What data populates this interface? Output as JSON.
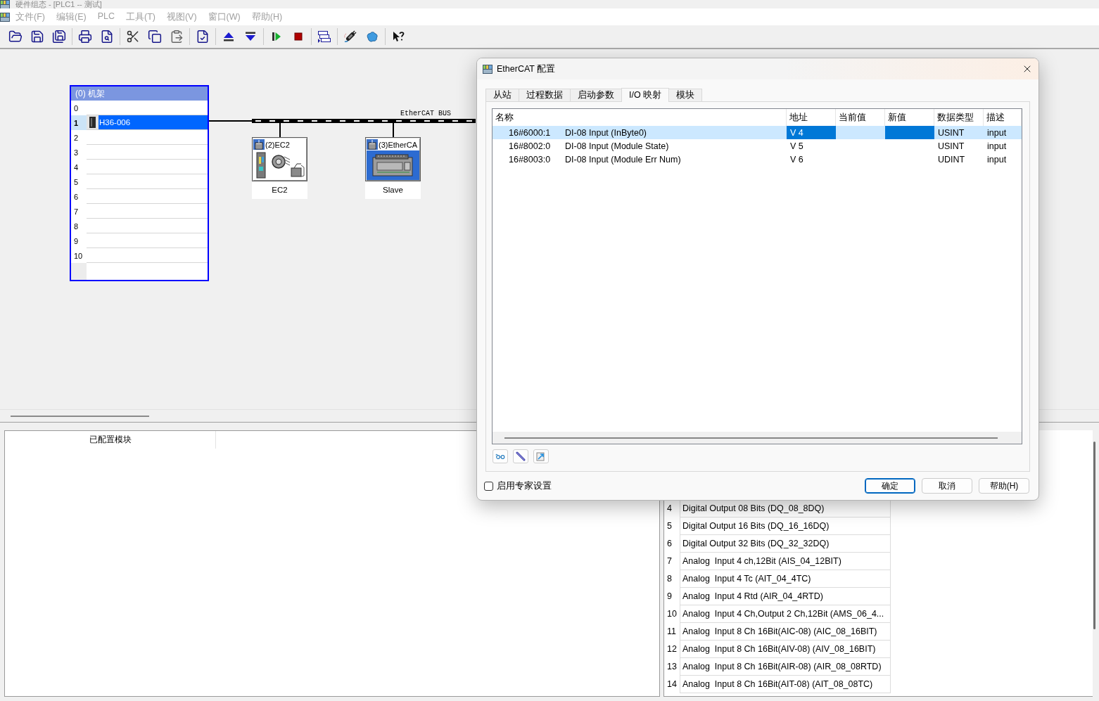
{
  "window": {
    "title": "硬件组态 - [PLC1 -- 测试]"
  },
  "menu": [
    {
      "label": "文件(F)",
      "disabled": true
    },
    {
      "label": "编辑(E)",
      "disabled": true
    },
    {
      "label": "PLC",
      "disabled": true
    },
    {
      "label": "工具(T)",
      "disabled": true
    },
    {
      "label": "视图(V)",
      "disabled": true
    },
    {
      "label": "窗口(W)",
      "disabled": true
    },
    {
      "label": "帮助(H)",
      "disabled": true
    }
  ],
  "rack": {
    "title": "(0) 机架",
    "slots": [
      {
        "number": "0",
        "selected": false
      },
      {
        "number": "1",
        "module": "H36-006",
        "selected": true
      },
      {
        "number": "2",
        "selected": false
      },
      {
        "number": "3",
        "selected": false
      },
      {
        "number": "4",
        "selected": false
      },
      {
        "number": "5",
        "selected": false
      },
      {
        "number": "6",
        "selected": false
      },
      {
        "number": "7",
        "selected": false
      },
      {
        "number": "8",
        "selected": false
      },
      {
        "number": "9",
        "selected": false
      },
      {
        "number": "10",
        "selected": false
      }
    ]
  },
  "bus": {
    "label": "EtherCAT BUS",
    "nodes": [
      {
        "title": "(2)EC2",
        "label": "EC2",
        "kind": "drive",
        "selected": false
      },
      {
        "title": "(3)EtherCA",
        "label": "Slave",
        "kind": "plc",
        "selected": true
      }
    ]
  },
  "configured_modules": {
    "header": "已配置模块"
  },
  "module_list": {
    "rows": [
      {
        "number": "4",
        "name": "Digital Output 08 Bits (DQ_08_8DQ)"
      },
      {
        "number": "5",
        "name": "Digital Output 16 Bits (DQ_16_16DQ)"
      },
      {
        "number": "6",
        "name": "Digital Output 32 Bits (DQ_32_32DQ)"
      },
      {
        "number": "7",
        "name": "Analog  Input 4 ch,12Bit (AIS_04_12BIT)"
      },
      {
        "number": "8",
        "name": "Analog  Input 4 Tc (AIT_04_4TC)"
      },
      {
        "number": "9",
        "name": "Analog  Input 4 Rtd (AIR_04_4RTD)"
      },
      {
        "number": "10",
        "name": "Analog  Input 4 Ch,Output 2 Ch,12Bit (AMS_06_4..."
      },
      {
        "number": "11",
        "name": "Analog  Input 8 Ch 16Bit(AIC-08) (AIC_08_16BIT)"
      },
      {
        "number": "12",
        "name": "Analog  Input 8 Ch 16Bit(AIV-08) (AIV_08_16BIT)"
      },
      {
        "number": "13",
        "name": "Analog  Input 8 Ch 16Bit(AIR-08) (AIR_08_08RTD)"
      },
      {
        "number": "14",
        "name": "Analog  Input 8 Ch 16Bit(AIT-08) (AIT_08_08TC)"
      }
    ]
  },
  "dialog": {
    "title": "EtherCAT 配置",
    "tabs": [
      {
        "label": "从站",
        "selected": false
      },
      {
        "label": "过程数据",
        "selected": false
      },
      {
        "label": "启动参数",
        "selected": false
      },
      {
        "label": "I/O 映射",
        "selected": true
      },
      {
        "label": "模块",
        "selected": false
      }
    ],
    "table": {
      "columns": [
        "名称",
        "地址",
        "当前值",
        "新值",
        "数据类型",
        "描述"
      ],
      "rows": [
        {
          "index": "16#6000:1",
          "name": "DI-08 Input (InByte0)",
          "address": "V 4",
          "data_type": "USINT",
          "description": "input",
          "selected": true
        },
        {
          "index": "16#8002:0",
          "name": "DI-08 Input (Module State)",
          "address": "V 5",
          "data_type": "USINT",
          "description": "input",
          "selected": false
        },
        {
          "index": "16#8003:0",
          "name": "DI-08 Input (Module Err Num)",
          "address": "V 6",
          "data_type": "UDINT",
          "description": "input",
          "selected": false
        }
      ]
    },
    "expert_settings": {
      "label": "启用专家设置",
      "checked": false
    },
    "buttons": [
      {
        "label": "确定",
        "default": true
      },
      {
        "label": "取消",
        "default": false
      },
      {
        "label": "帮助(H)",
        "default": false
      }
    ]
  }
}
